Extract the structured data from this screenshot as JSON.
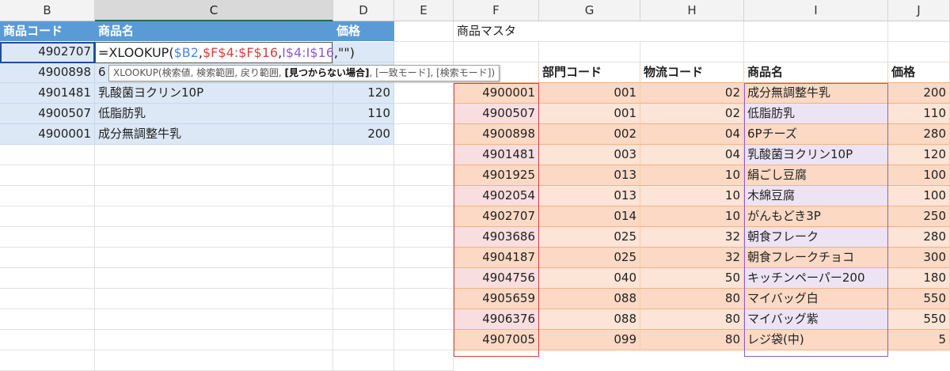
{
  "columns": [
    "B",
    "C",
    "D",
    "E",
    "F",
    "G",
    "H",
    "I",
    "J"
  ],
  "left_table": {
    "headers": [
      "商品コード",
      "商品名",
      "価格"
    ],
    "rows": [
      {
        "code": "4902707",
        "name": "",
        "price": ""
      },
      {
        "code": "4900898",
        "name": "6",
        "price": ""
      },
      {
        "code": "4901481",
        "name": "乳酸菌ヨクリン10P",
        "price": "120"
      },
      {
        "code": "4900507",
        "name": "低脂肪乳",
        "price": "110"
      },
      {
        "code": "4900001",
        "name": "成分無調整牛乳",
        "price": "200"
      }
    ]
  },
  "formula": {
    "prefix": "=XLOOKUP(",
    "arg1": "$B2",
    "comma1": ",",
    "arg2": "$F$4:$F$16",
    "comma2": ",",
    "arg3": "I$4:I$16",
    "comma3": ",",
    "arg4": "\"\"",
    "suffix": ")"
  },
  "tooltip": {
    "fn": "XLOOKUP(",
    "args_before": "検索値, 検索範囲, 戻り範囲, ",
    "current_arg": "[見つからない場合]",
    "args_after": ", [一致モード], [検索モード])"
  },
  "master": {
    "title": "商品マスタ",
    "headers": [
      "",
      "部門コード",
      "物流コード",
      "商品名",
      "価格"
    ],
    "rows": [
      [
        "4900001",
        "001",
        "02",
        "成分無調整牛乳",
        "200"
      ],
      [
        "4900507",
        "001",
        "02",
        "低脂肪乳",
        "110"
      ],
      [
        "4900898",
        "002",
        "04",
        "6Pチーズ",
        "280"
      ],
      [
        "4901481",
        "003",
        "04",
        "乳酸菌ヨクリン10P",
        "120"
      ],
      [
        "4901925",
        "013",
        "10",
        "絹ごし豆腐",
        "100"
      ],
      [
        "4902054",
        "013",
        "10",
        "木綿豆腐",
        "100"
      ],
      [
        "4902707",
        "014",
        "10",
        "がんもどき3P",
        "250"
      ],
      [
        "4903686",
        "025",
        "32",
        "朝食フレーク",
        "280"
      ],
      [
        "4904187",
        "025",
        "32",
        "朝食フレークチョコ",
        "300"
      ],
      [
        "4904756",
        "040",
        "50",
        "キッチンペーパー200",
        "180"
      ],
      [
        "4905659",
        "088",
        "80",
        "マイバッグ白",
        "550"
      ],
      [
        "4906376",
        "088",
        "80",
        "マイバッグ紫",
        "550"
      ],
      [
        "4907005",
        "099",
        "80",
        "レジ袋(中)",
        "5"
      ]
    ]
  },
  "colors": {
    "header_blue": "#5b9bd5",
    "light_blue": "#dce8f5",
    "orange_light": "#fce4d6",
    "ref_blue": "#4a86e8",
    "ref_red": "#d94040",
    "ref_purple": "#8c5bd6"
  }
}
